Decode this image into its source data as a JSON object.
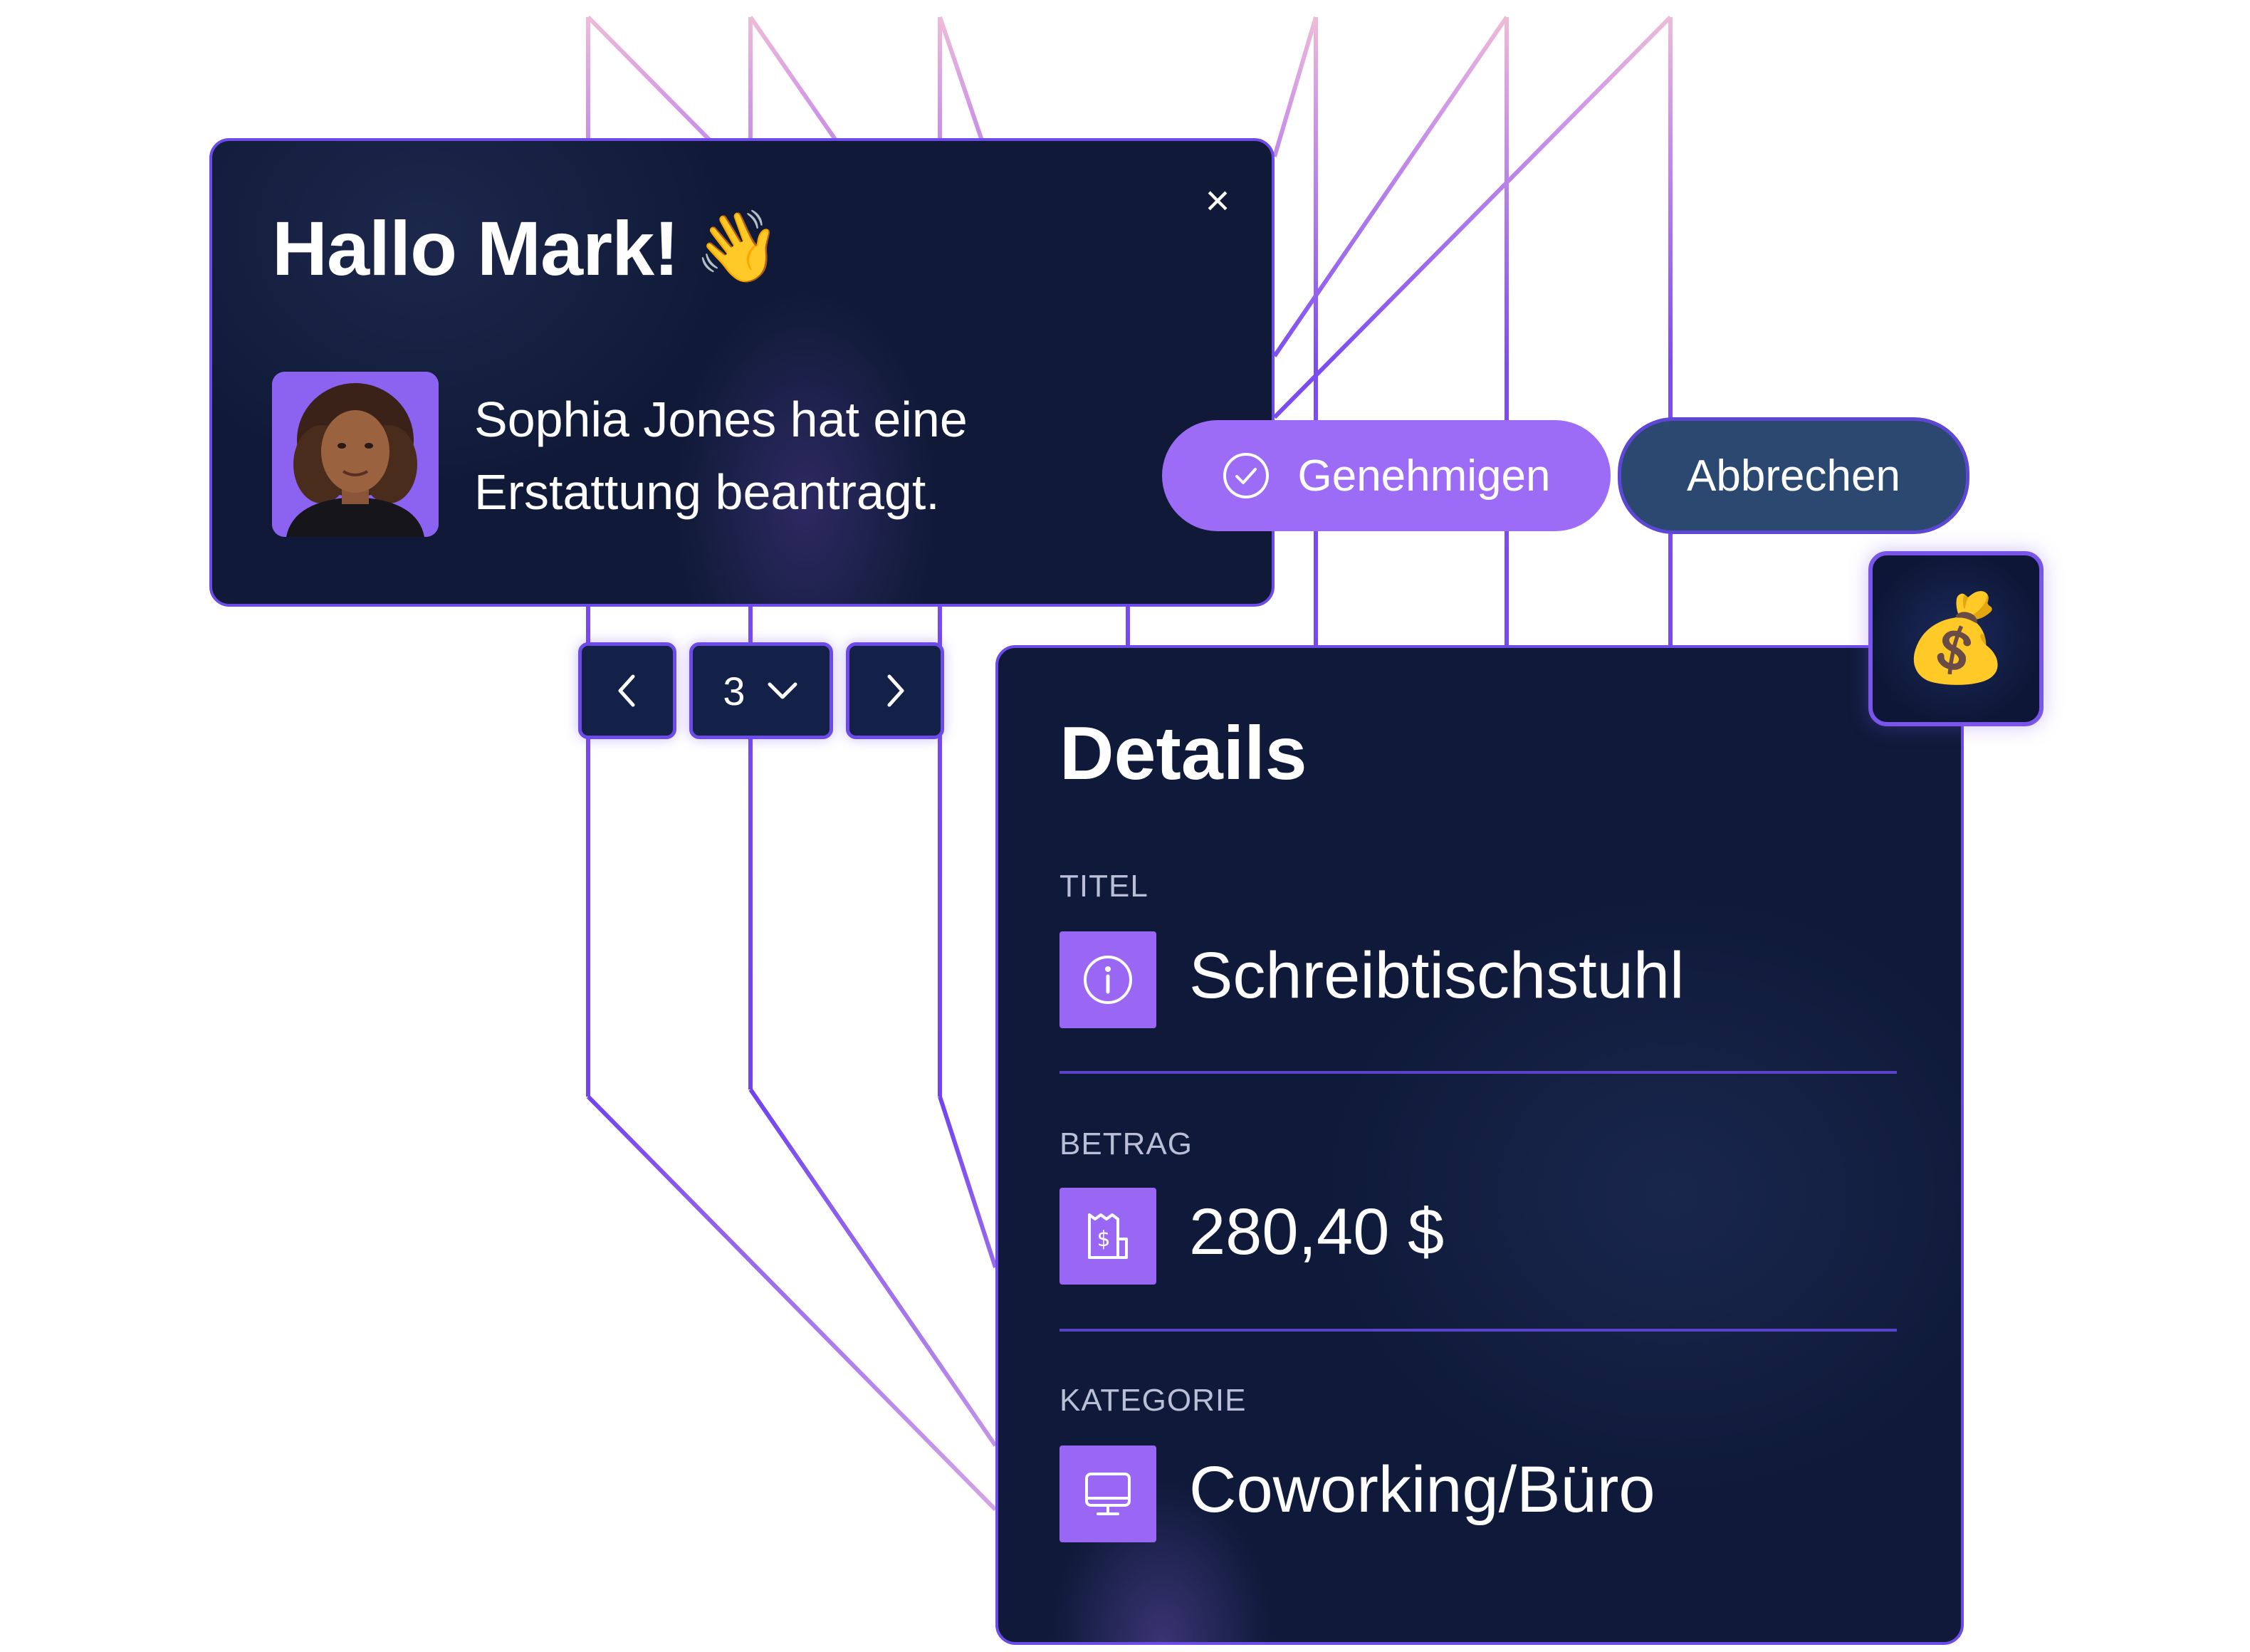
{
  "notification": {
    "greeting": "Hallo Mark!",
    "wave_emoji": "👋",
    "message": "Sophia Jones hat eine Erstattung beantragt.",
    "close_symbol": "×",
    "avatar_alt": "Sophia Jones"
  },
  "actions": {
    "approve_label": "Genehmigen",
    "cancel_label": "Abbrechen"
  },
  "pager": {
    "prev_symbol": "‹",
    "current_page": "3",
    "next_symbol": "›"
  },
  "badge": {
    "emoji": "💰"
  },
  "details": {
    "title": "Details",
    "fields": [
      {
        "label": "TITEL",
        "value": "Schreibtischstuhl",
        "icon": "info-icon"
      },
      {
        "label": "BETRAG",
        "value": "280,40 $",
        "icon": "receipt-dollar-icon"
      },
      {
        "label": "KATEGORIE",
        "value": "Coworking/Büro",
        "icon": "monitor-icon"
      }
    ]
  },
  "colors": {
    "panel_bg": "#101a38",
    "accent_purple": "#9d6cf7",
    "border_purple": "#6c4be6",
    "cancel_bg": "#2a4870"
  }
}
